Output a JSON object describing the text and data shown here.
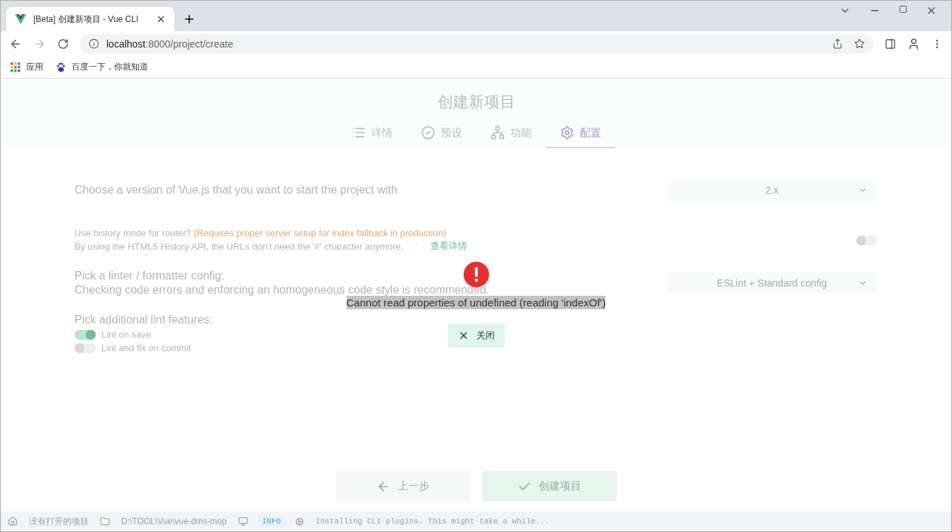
{
  "browser": {
    "tabs": [
      {
        "title": "[Beta] 创建新项目 - Vue CLI",
        "selected": true
      }
    ],
    "address": {
      "host": "localhost",
      "path": ":8000/project/create"
    },
    "bookmarks": [
      {
        "label": "应用",
        "kind": "apps"
      },
      {
        "label": "百度一下，你就知道",
        "kind": "paw"
      }
    ]
  },
  "page": {
    "title": "创建新项目",
    "steps": [
      {
        "label": "详情",
        "kind": "details",
        "selected": false
      },
      {
        "label": "预设",
        "kind": "preset",
        "selected": false
      },
      {
        "label": "功能",
        "kind": "features",
        "selected": false
      },
      {
        "label": "配置",
        "kind": "config",
        "selected": true
      }
    ],
    "prompts": [
      {
        "kind": "select",
        "title": "Choose a version of Vue.js that you want to start the project with",
        "value": "2.x"
      },
      {
        "kind": "toggle",
        "title": "Use history mode for router?",
        "note": "(Requires proper server setup for index fallback in production)",
        "description": "By using the HTML5 History API, the URLs don't need the '#' character anymore.",
        "link": "查看详情",
        "on": false
      },
      {
        "kind": "select",
        "title": "Pick a linter / formatter config:",
        "description": "Checking code errors and enforcing an homogeneous code style is recommended.",
        "value": "ESLint + Standard config"
      },
      {
        "kind": "checklist",
        "title": "Pick additional lint features:",
        "options": [
          {
            "label": "Lint on save",
            "on": true
          },
          {
            "label": "Lint and fix on commit",
            "on": false
          }
        ]
      }
    ],
    "buttons": [
      {
        "label": "上一步",
        "kind": "back"
      },
      {
        "label": "创建项目",
        "kind": "create"
      }
    ]
  },
  "error": {
    "message": "Cannot read properties of undefined (reading 'indexOf')",
    "button": "关闭"
  },
  "status_bar": {
    "project": "没有打开的项目",
    "path": "D:\\TOOL\\Vue\\vue-dms-mop",
    "badge": "INFO",
    "log": "Installing CLI plugins. This might take a while..."
  }
}
